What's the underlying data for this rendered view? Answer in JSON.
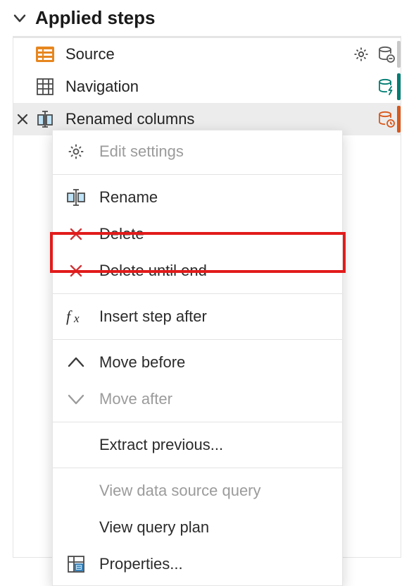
{
  "header": {
    "title": "Applied steps"
  },
  "steps": [
    {
      "label": "Source"
    },
    {
      "label": "Navigation"
    },
    {
      "label": "Renamed columns"
    }
  ],
  "menu": {
    "edit_settings": "Edit settings",
    "rename": "Rename",
    "delete": "Delete",
    "delete_until_end": "Delete until end",
    "insert_step_after": "Insert step after",
    "move_before": "Move before",
    "move_after": "Move after",
    "extract_previous": "Extract previous...",
    "view_data_source_query": "View data source query",
    "view_query_plan": "View query plan",
    "properties": "Properties..."
  },
  "colors": {
    "accent": "#d8581c",
    "teal": "#007d73",
    "red": "#d13438"
  }
}
